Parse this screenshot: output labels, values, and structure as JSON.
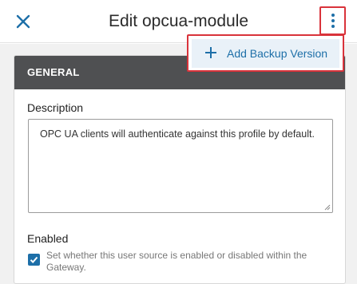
{
  "header": {
    "title": "Edit opcua-module",
    "close_icon": "close-icon",
    "more_icon": "kebab-vertical-icon"
  },
  "menu": {
    "items": [
      {
        "label": "Add Backup Version",
        "icon": "plus-icon"
      }
    ]
  },
  "panel": {
    "section_title": "GENERAL",
    "description": {
      "label": "Description",
      "value": "OPC UA clients will authenticate against this profile by default."
    },
    "enabled": {
      "label": "Enabled",
      "checked": true,
      "help_text": "Set whether this user source is enabled or disabled within the Gateway."
    }
  },
  "colors": {
    "accent": "#1d6fa8",
    "highlight": "#d9333b",
    "section_header": "#4f5052"
  }
}
